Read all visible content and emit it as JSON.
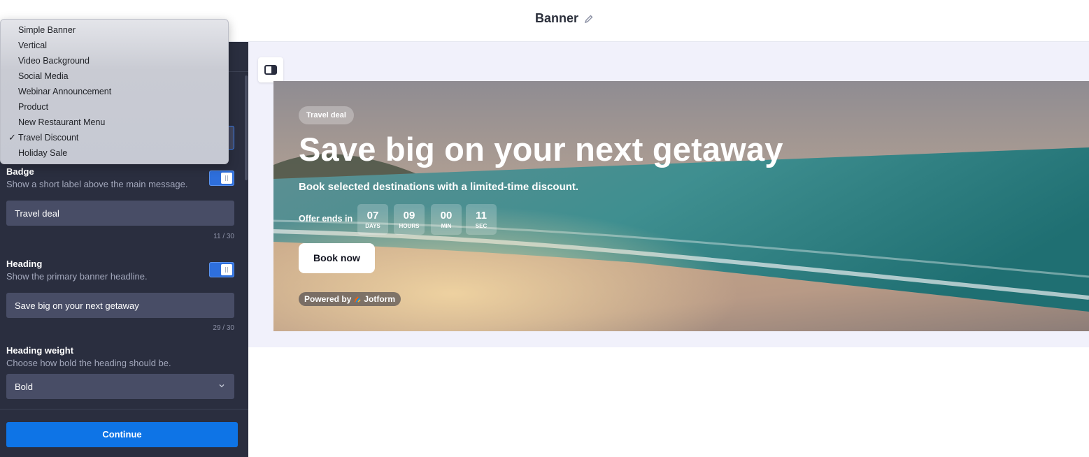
{
  "header": {
    "title": "Banner"
  },
  "dropdown": {
    "items": [
      "Simple Banner",
      "Vertical",
      "Video Background",
      "Social Media",
      "Webinar Announcement",
      "Product",
      "New Restaurant Menu",
      "Travel Discount",
      "Holiday Sale"
    ],
    "selected_index": 7,
    "check_glyph": "✓"
  },
  "settings": {
    "badge": {
      "label": "Badge",
      "description": "Show a short label above the main message.",
      "enabled": true,
      "value": "Travel deal",
      "counter": "11 / 30"
    },
    "heading": {
      "label": "Heading",
      "description": "Show the primary banner headline.",
      "enabled": true,
      "value": "Save big on your next getaway",
      "counter": "29 / 30"
    },
    "heading_weight": {
      "label": "Heading weight",
      "description": "Choose how bold the heading should be.",
      "value": "Bold"
    }
  },
  "continue_label": "Continue",
  "banner": {
    "badge": "Travel deal",
    "headline": "Save big on your next getaway",
    "subline": "Book selected destinations with a limited-time discount.",
    "offer_label": "Offer ends in",
    "countdown": [
      {
        "value": "07",
        "unit": "DAYS"
      },
      {
        "value": "09",
        "unit": "HOURS"
      },
      {
        "value": "00",
        "unit": "MIN"
      },
      {
        "value": "11",
        "unit": "SEC"
      }
    ],
    "cta": "Book now",
    "powered_prefix": "Powered by",
    "powered_brand": "Jotform"
  },
  "colors": {
    "accent": "#0e74e6",
    "panel": "#2a2e3f",
    "preview_bg": "#f1f1fb"
  },
  "icons": [
    "pencil-icon",
    "layout-toggle-icon",
    "chevron-down-icon",
    "jotform-logo-icon",
    "checkmark-icon"
  ]
}
